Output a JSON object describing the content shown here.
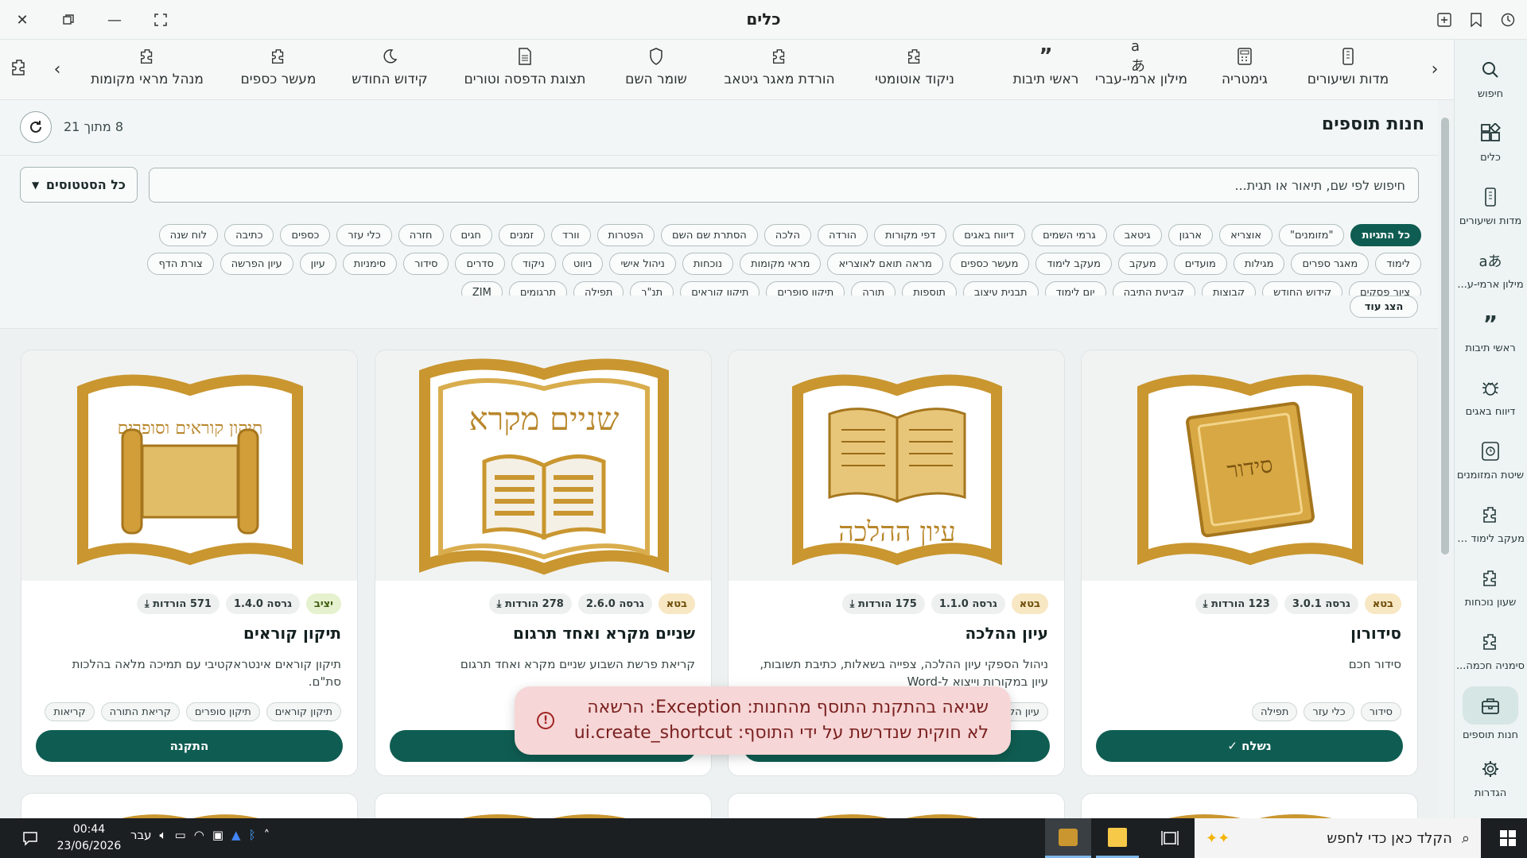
{
  "window": {
    "title": "כלים"
  },
  "toolbar": {
    "items": [
      {
        "label": "מדות ושיעורים",
        "icon": "phone-icon"
      },
      {
        "label": "גימטריה",
        "icon": "calculator-icon"
      },
      {
        "label": "מילון ארמי-עברי",
        "icon": "translate-icon"
      },
      {
        "label": "ראשי תיבות",
        "icon": "quote-icon"
      },
      {
        "label": "ניקוד אוטומטי",
        "icon": "puzzle-icon"
      },
      {
        "label": "הורדת מאגר גיטאב",
        "icon": "puzzle-icon"
      },
      {
        "label": "שומר השם",
        "icon": "shield-icon"
      },
      {
        "label": "תצוגת הדפסה וטורים",
        "icon": "print-icon"
      },
      {
        "label": "קידוש החודש",
        "icon": "moon-icon"
      },
      {
        "label": "מעשר כספים",
        "icon": "puzzle-icon"
      },
      {
        "label": "מנהל מראי מקומות",
        "icon": "puzzle-icon"
      }
    ]
  },
  "rail": {
    "items": [
      {
        "label": "חיפוש",
        "icon": "search-icon"
      },
      {
        "label": "כלים",
        "icon": "tools-icon"
      },
      {
        "label": "מדות ושיעורים",
        "icon": "phone-icon"
      },
      {
        "label": "מילון ארמי-ע...",
        "icon": "translate-icon"
      },
      {
        "label": "ראשי תיבות",
        "icon": "quote-icon"
      },
      {
        "label": "דיווח באגים",
        "icon": "bug-icon"
      },
      {
        "label": "שיטת המזומנים",
        "icon": "clock-icon"
      },
      {
        "label": "מעקב לימוד מ...",
        "icon": "puzzle-icon"
      },
      {
        "label": "שעון נוכחות",
        "icon": "puzzle-icon"
      },
      {
        "label": "סימניה חכמה...",
        "icon": "puzzle-icon"
      },
      {
        "label": "חנות תוספים",
        "icon": "store-icon"
      },
      {
        "label": "הגדרות",
        "icon": "gear-icon"
      }
    ]
  },
  "store": {
    "title": "חנות תוספים",
    "updates": "8 מתוך 21",
    "search_placeholder": "חיפוש לפי שם, תיאור או תגית...",
    "status_filter": "כל הסטטוסים",
    "show_more": "הצג עוד",
    "tags_row1": [
      "כל התגיות",
      "\"מזומנים\"",
      "אוצריא",
      "ארגון",
      "גיטאב",
      "גרמי השמים",
      "דיווח באגים",
      "דפי מקורות",
      "הורדה",
      "הלכה",
      "הסתרת שם השם",
      "הפטרות",
      "וורד",
      "זמנים",
      "חגים",
      "חזרה",
      "כלי עזר",
      "כספים",
      "כתיבה",
      "לוח שנה"
    ],
    "tags_row2": [
      "לימוד",
      "מאגר ספרים",
      "מגילות",
      "מועדים",
      "מעקב",
      "מעקב לימוד",
      "מעשר כספים",
      "מראה תואם לאוצריא",
      "מראי מקומות",
      "נוכחות",
      "ניהול אישי",
      "ניווט",
      "ניקוד",
      "סדרים",
      "סידור",
      "סימניות",
      "עיון",
      "עיון הפרשה",
      "צורת הדף"
    ],
    "tags_row3": [
      "ציור פסקים",
      "קידוש החודש",
      "קבוצות",
      "קביעת התיבה",
      "יום לימוד",
      "תבנית עיצוב",
      "תוספות",
      "תורה",
      "תיקון סופרים",
      "תיקון קוראים",
      "תנ\"ך",
      "תפילה",
      "תרגומים",
      "ZIM"
    ]
  },
  "cards": [
    {
      "name": "סידורון",
      "status": "בטא",
      "version": "גרסה 3.0.1",
      "downloads": "123 הורדות",
      "description": "סידור חכם",
      "tags": [
        "סידור",
        "כלי עזר",
        "תפילה"
      ],
      "action": "נשלח ✓",
      "image_text": "סידור"
    },
    {
      "name": "עיון ההלכה",
      "status": "בטא",
      "version": "גרסה 1.1.0",
      "downloads": "175 הורדות",
      "description": "ניהול הספקי עיון ההלכה, צפייה בשאלות, כתיבת תשובות, עיון במקורות וייצוא ל-Word",
      "tags": [
        "עיון הלכה"
      ],
      "action": "התקנה",
      "image_text": "עיון ההלכה"
    },
    {
      "name": "שניים מקרא ואחד תרגום",
      "status": "בטא",
      "version": "גרסה 2.6.0",
      "downloads": "278 הורדות",
      "description": "קריאת פרשת השבוע שניים מקרא ואחד תרגום",
      "tags": [],
      "action": "התקנה",
      "image_text": "שניים מקרא"
    },
    {
      "name": "תיקון קוראים",
      "status": "יציב",
      "version": "גרסה 1.4.0",
      "downloads": "571 הורדות",
      "description": "תיקון קוראים אינטראקטיבי עם תמיכה מלאה בהלכות סת\"ם.",
      "tags": [
        "תיקון קוראים",
        "תיקון סופרים",
        "קריאת התורה",
        "קריאות"
      ],
      "action": "התקנה",
      "image_text": "תיקון קוראים וסופרים"
    }
  ],
  "toast": {
    "message": "שגיאה בהתקנת התוסף מהחנות: Exception: הרשאה לא חוקית שנדרשת על ידי התוסף: ui.create_shortcut"
  },
  "taskbar": {
    "search_placeholder": "הקלד כאן כדי לחפש",
    "time": "00:44",
    "date": "23/06/2026",
    "language": "עבר"
  },
  "colors": {
    "accent": "#0f5d52",
    "toast_bg": "#f6d6d6",
    "toast_text": "#7a1f1f",
    "gold": "#c9962f"
  }
}
